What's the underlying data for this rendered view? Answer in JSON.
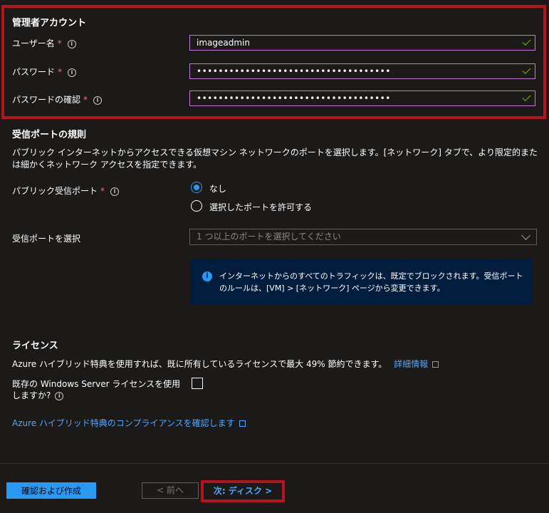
{
  "admin": {
    "title": "管理者アカウント",
    "username_label": "ユーザー名",
    "username_value": "imageadmin",
    "password_label": "パスワード",
    "password_value": "••••••••••••••••••••••••••••••••••••",
    "confirm_label": "パスワードの確認",
    "confirm_value": "••••••••••••••••••••••••••••••••••••",
    "required_mark": "*",
    "info_glyph": "i"
  },
  "inbound": {
    "title": "受信ポートの規則",
    "description": "パブリック インターネットからアクセスできる仮想マシン ネットワークのポートを選択します。[ネットワーク] タブで、より限定的または細かくネットワーク アクセスを指定できます。",
    "public_ports_label": "パブリック受信ポート",
    "option_none": "なし",
    "option_allow": "選択したポートを許可する",
    "select_ports_label": "受信ポートを選択",
    "select_placeholder": "1 つ以上のポートを選択してください",
    "info_text": "インターネットからのすべてのトラフィックは、既定でブロックされます。受信ポートのルールは、[VM] > [ネットワーク] ページから変更できます。"
  },
  "license": {
    "title": "ライセンス",
    "description": "Azure ハイブリッド特典を使用すれば、既に所有しているライセンスで最大 49% 節約できます。",
    "more_info_link": "詳細情報",
    "existing_license_question": "既存の Windows Server ライセンスを使用しますか?",
    "compliance_link": "Azure ハイブリッド特典のコンプライアンスを確認します"
  },
  "footer": {
    "review_create": "確認および作成",
    "prev": "< 前へ",
    "next": "次: ディスク >"
  },
  "colors": {
    "accent": "#2899f5",
    "highlight_border": "#b4141e",
    "field_border": "#c27ad9",
    "valid_check": "#6bb700"
  }
}
